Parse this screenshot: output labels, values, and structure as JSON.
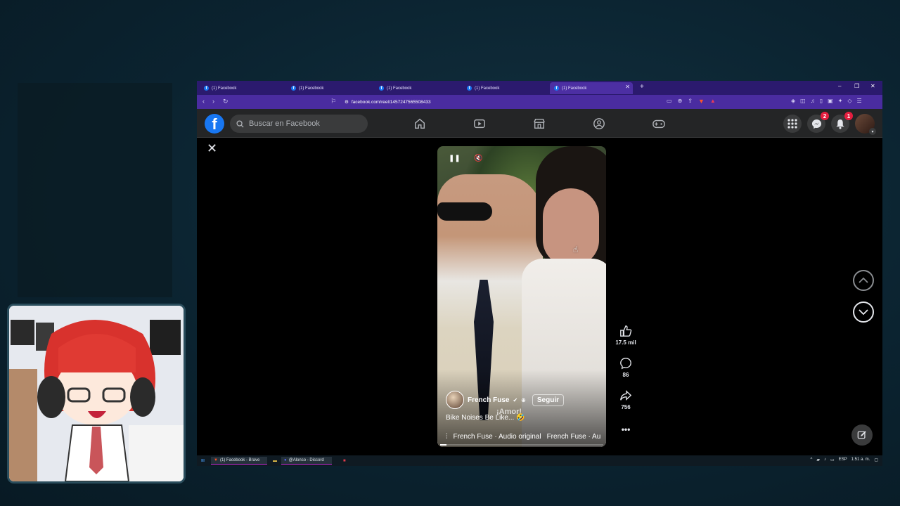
{
  "browser": {
    "tabs": [
      {
        "title": "(1) Facebook"
      },
      {
        "title": "(1) Facebook"
      },
      {
        "title": "(1) Facebook"
      },
      {
        "title": "(1) Facebook"
      },
      {
        "title": "(1) Facebook",
        "active": true
      }
    ],
    "url": "facebook.com/reel/1457247565508433"
  },
  "facebook": {
    "search_placeholder": "Buscar en Facebook",
    "messenger_badge": "2",
    "notifications_badge": "1"
  },
  "reel": {
    "creator_name": "French Fuse",
    "follow_label": "Seguir",
    "caption": "Bike Noises Be Like... 🤣",
    "overlay_text": "¡Amor!",
    "audio_text": "French Fuse · Audio original",
    "audio_marquee": "French Fuse · Au",
    "likes": "17.5 mil",
    "comments": "86",
    "shares": "756",
    "progress": 0.04
  },
  "taskbar": {
    "items": [
      "(1) Facebook - Brave",
      "@Alonso - Discord"
    ],
    "lang": "ESP",
    "time": "1:51 a. m."
  }
}
